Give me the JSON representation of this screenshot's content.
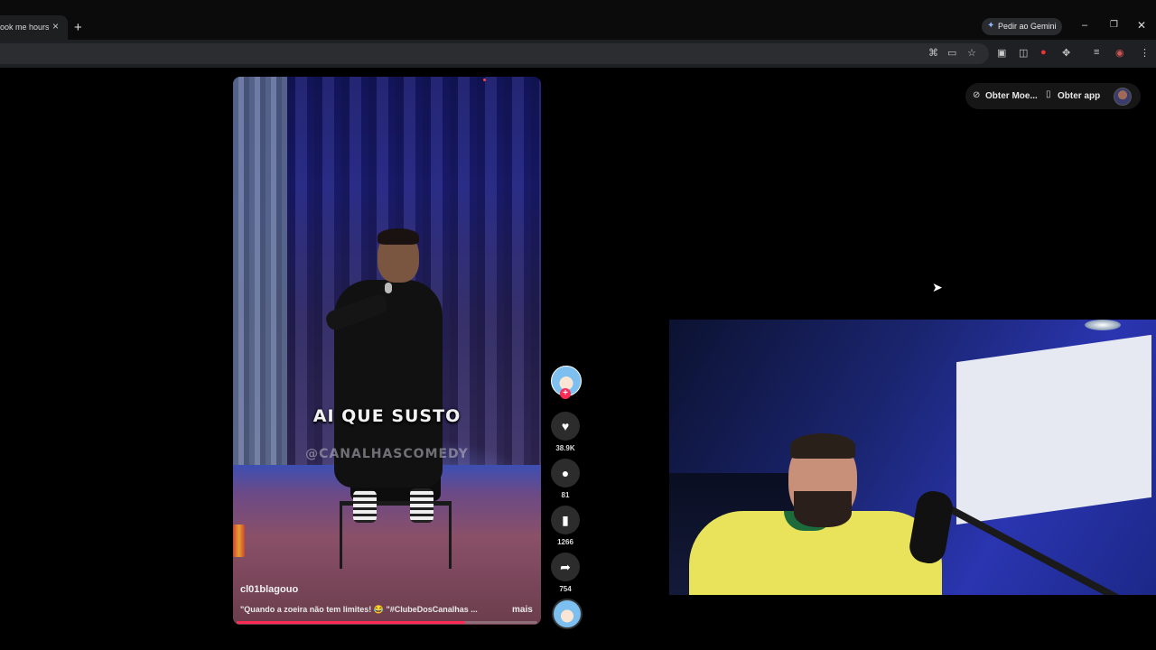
{
  "browser": {
    "tab_title": "ook me hours t",
    "tab_close": "×",
    "new_tab": "+",
    "gemini_label": "Pedir ao Gemini",
    "window_controls": {
      "minimize": "–",
      "maximize": "❐",
      "close": "✕"
    },
    "toolbar_icons": [
      "translate-icon",
      "cast-icon",
      "star-icon",
      "extension-icon",
      "extension-icon",
      "record-icon",
      "puzzle-icon",
      "media-icon",
      "profile-icon",
      "menu-icon"
    ]
  },
  "header": {
    "coins_label": "Obter Moe...",
    "app_label": "Obter app"
  },
  "video": {
    "subtitle": "AI QUE SUSTO",
    "watermark": "@CANALHASCOMEDY",
    "username": "cl01blagouo",
    "caption": "\"Quando a zoeira não tem limites! 😂 \"#ClubeDosCanalhas ...",
    "more_label": "mais",
    "progress": 0.76
  },
  "actions": {
    "follow_plus": "+",
    "likes": "38.9K",
    "comments": "81",
    "saves": "1266",
    "shares": "754"
  },
  "colors": {
    "accent": "#fe2c55",
    "page_bg": "#000000",
    "chrome_bg": "#1f2023"
  }
}
